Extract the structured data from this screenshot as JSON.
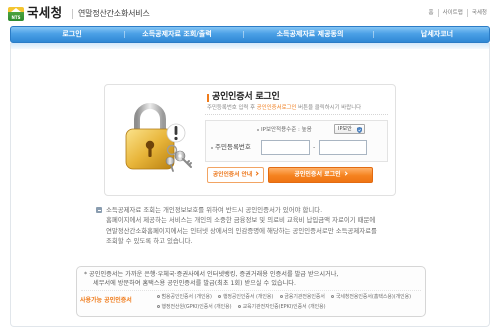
{
  "header": {
    "logo_badge": "NTS",
    "logo_text": "국세청",
    "service_title": "연말정산간소화서비스",
    "util_links": [
      "홈",
      "사이트맵",
      "국세청"
    ]
  },
  "nav": {
    "items": [
      "로그인",
      "소득공제자료 조회/출력",
      "소득공제자료 제공동의",
      "납세자코너"
    ]
  },
  "login": {
    "title": "공인인증서 로그인",
    "desc_before": "주민등록번호 입력 후 ",
    "desc_highlight": "공인인증서로그인",
    "desc_after": " 버튼을 클릭하시기 바랍니다",
    "ip_security_label": "IP보안적용수준 : 높음",
    "ip_security_button": "IP보안",
    "rrn_label": "주민등록번호",
    "rrn_front_value": "",
    "rrn_back_value": "",
    "rrn_separator": "-",
    "guide_button": "공인인증서 안내",
    "login_button": "공인인증서 로그인"
  },
  "notice": {
    "lines": [
      "소득공제자료 조회는 개인정보보호를 위하여 반드시 공인인증서가 있어야 합니다.",
      "홈페이지에서 제공하는 서비스는 개인의 소중한 금융정보 및 의료비 교육비 납입금액 자료이기 때문에",
      "연말정산간소화홈페이지에서는 인터넷 상에서의 인감증명에 해당하는 공인인증서로만 소득공제자료를",
      "조회할 수 있도록 하고 있습니다."
    ]
  },
  "cert_info": {
    "lines": [
      "* 공인인증서는 가까운 은행·우체국·증권사에서 인터넷뱅킹, 증권거래용 인증서를 발급 받으시거나,",
      "세무서에 방문하여 홈택스용 공인인증서를 발급(최초 1회) 받으실 수 있습니다."
    ],
    "available_label": "사용가능 공인인증서",
    "available_rows": [
      [
        "범용공인인증서 (개인용)",
        "행정공인인증서 (개인용)",
        "금융기관전용인증서",
        "국세청전용인증서(홈택스용)(개인용)"
      ],
      [
        "행정전산원(GPKI)인증서 (개인용)",
        "교육기관전자인증(EPKI)인증서 (개인용)"
      ]
    ]
  },
  "icons": {
    "logo": "nts-logo-icon",
    "illustration": "padlock-keys-illustration",
    "ip_button": "shield-icon",
    "button_arrow": "chevron-right-icon",
    "notice": "notice-icon",
    "cert_bullet": "circle-bullet-icon"
  },
  "colors": {
    "nav_blue": "#3d95e1",
    "accent_orange": "#f07b1a",
    "text_gray": "#666666",
    "border_gray": "#e0e0e0",
    "lock_gold": "#e8b53a"
  }
}
